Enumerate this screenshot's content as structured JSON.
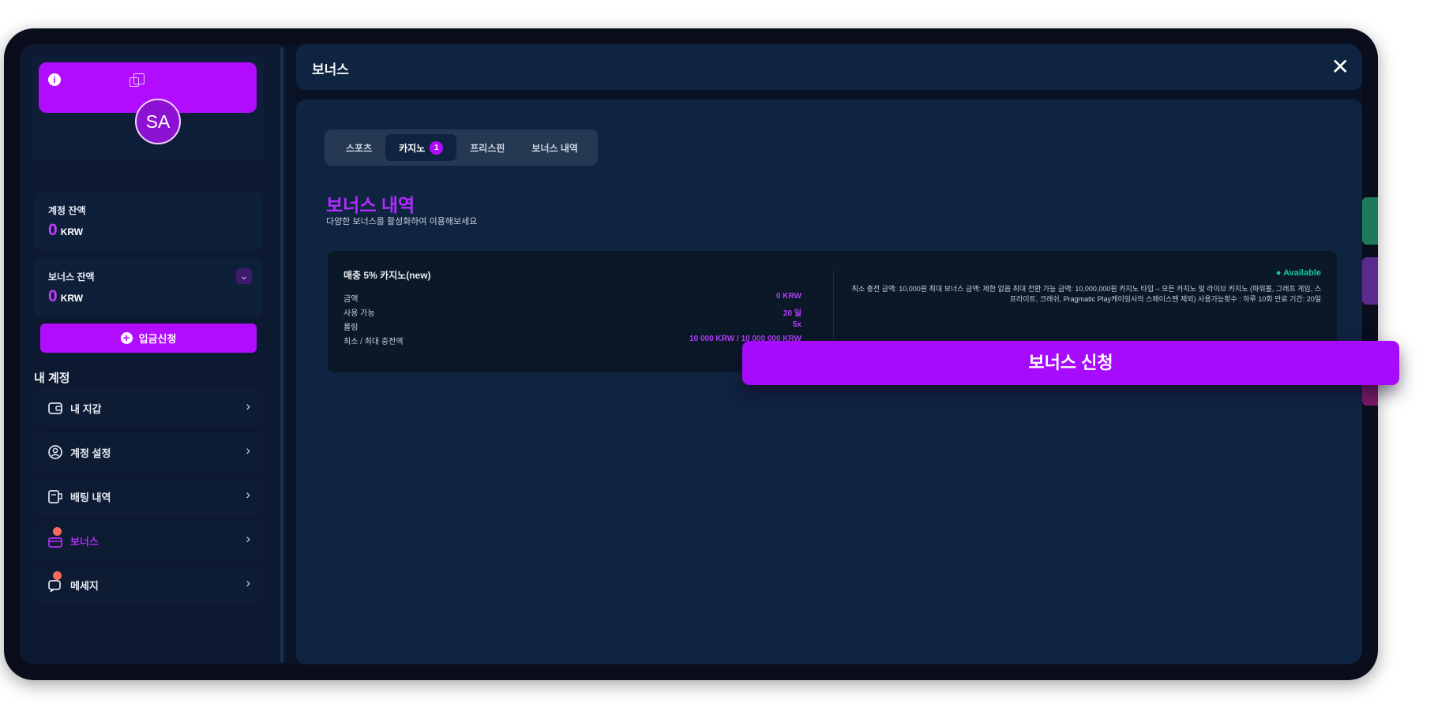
{
  "profile": {
    "avatar_initials": "SA"
  },
  "balances": {
    "account": {
      "label": "계정 잔액",
      "amount": "0",
      "currency": "KRW"
    },
    "bonus": {
      "label": "보너스 잔액",
      "amount": "0",
      "currency": "KRW"
    }
  },
  "deposit_button": {
    "label": "입금신청"
  },
  "account_section": {
    "title": "내 계정",
    "items": [
      {
        "label": "내 지갑",
        "icon": "wallet-icon"
      },
      {
        "label": "계정 설정",
        "icon": "user-icon"
      },
      {
        "label": "배팅 내역",
        "icon": "bet-history-icon"
      },
      {
        "label": "보너스",
        "icon": "gift-icon",
        "badge": true
      },
      {
        "label": "메세지",
        "icon": "message-icon",
        "badge": true
      }
    ]
  },
  "header": {
    "title": "보너스"
  },
  "tabs": [
    {
      "label": "스포츠"
    },
    {
      "label": "카지노",
      "badge": "1"
    },
    {
      "label": "프리스핀"
    },
    {
      "label": "보너스 내역"
    }
  ],
  "content": {
    "title": "보너스 내역",
    "subtitle": "다양한 보너스를 활성화하여 이용해보세요"
  },
  "bonus_card": {
    "name": "매충 5% 카지노(new)",
    "rows": [
      {
        "label": "금액",
        "value": "0 KRW"
      },
      {
        "label": "사용 가능",
        "value": "20 일"
      },
      {
        "label": "롤링",
        "value": "5x"
      },
      {
        "label": "최소 / 최대 충전액",
        "value": "10 000 KRW / 10 000 000 KRW"
      }
    ],
    "status": "Available",
    "description": "최소 충전 금액: 10,000원 최대 보너스 금액: 제한 없음 최대 전환 가능 금액: 10,000,000원 카지노 타입 – 모든 카지노 및 라이브 카지노 (파워볼, 그래프 게임, 스프라이트, 크래쉬, Pragmatic Play케이밍사의 스페이스맨 제외) 사용가능횟수 : 하루 10회 만료 기간: 20일"
  },
  "apply_button": {
    "label": "보너스 신청"
  },
  "colors": {
    "accent": "#b20cff",
    "background": "#0a1326",
    "panel": "#0f2440",
    "status_available": "#18c69a"
  }
}
